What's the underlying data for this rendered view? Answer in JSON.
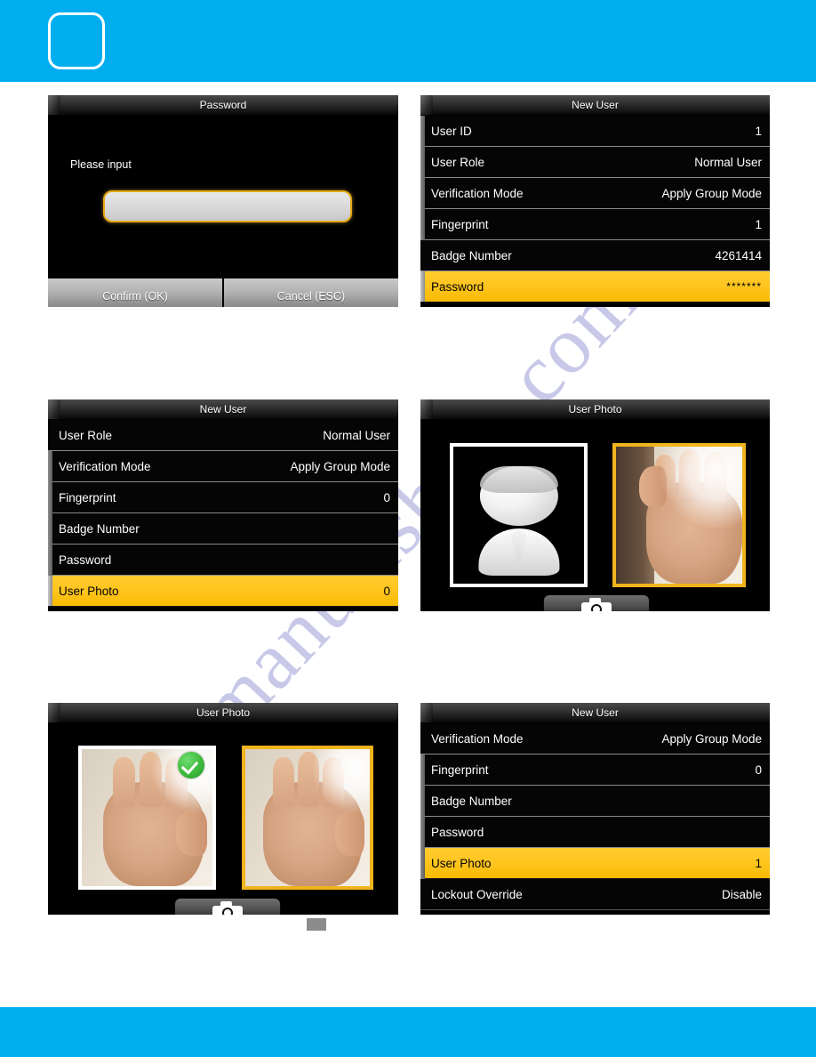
{
  "page": {
    "watermark": "manualshive.com",
    "accent_color": "#00aeef",
    "highlight_color": "#ffc51f",
    "frame_gold": "#f0b41c"
  },
  "panels": {
    "password_dialog": {
      "title": "Password",
      "prompt": "Please input",
      "input_value": "",
      "input_placeholder": "",
      "confirm_label": "Confirm (OK)",
      "cancel_label": "Cancel (ESC)"
    },
    "new_user_full": {
      "title": "New User",
      "rows": [
        {
          "label": "User ID",
          "value": "1",
          "selected": false
        },
        {
          "label": "User Role",
          "value": "Normal User",
          "selected": false
        },
        {
          "label": "Verification Mode",
          "value": "Apply Group Mode",
          "selected": false
        },
        {
          "label": "Fingerprint",
          "value": "1",
          "selected": false
        },
        {
          "label": "Badge Number",
          "value": "4261414",
          "selected": false
        },
        {
          "label": "Password",
          "value": "*******",
          "selected": true
        }
      ]
    },
    "new_user_photo_select": {
      "title": "New User",
      "rows": [
        {
          "label": "User Role",
          "value": "Normal User",
          "selected": false
        },
        {
          "label": "Verification Mode",
          "value": "Apply Group Mode",
          "selected": false
        },
        {
          "label": "Fingerprint",
          "value": "0",
          "selected": false
        },
        {
          "label": "Badge Number",
          "value": "",
          "selected": false
        },
        {
          "label": "Password",
          "value": "",
          "selected": false
        },
        {
          "label": "User Photo",
          "value": "0",
          "selected": true
        }
      ]
    },
    "user_photo_capture": {
      "title": "User Photo",
      "left_thumb_name": "default-avatar",
      "right_thumb_name": "live-camera-preview",
      "camera_button_label": "camera-icon"
    },
    "user_photo_captured": {
      "title": "User Photo",
      "left_thumb_name": "captured-photo",
      "right_thumb_name": "live-camera-preview",
      "camera_button_label": "camera-icon",
      "success_badge": "check-icon"
    },
    "new_user_lockout": {
      "title": "New User",
      "rows": [
        {
          "label": "Verification Mode",
          "value": "Apply Group Mode",
          "selected": false
        },
        {
          "label": "Fingerprint",
          "value": "0",
          "selected": false
        },
        {
          "label": "Badge Number",
          "value": "",
          "selected": false
        },
        {
          "label": "Password",
          "value": "",
          "selected": false
        },
        {
          "label": "User Photo",
          "value": "1",
          "selected": true
        },
        {
          "label": "Lockout Override",
          "value": "Disable",
          "selected": false
        }
      ]
    }
  }
}
